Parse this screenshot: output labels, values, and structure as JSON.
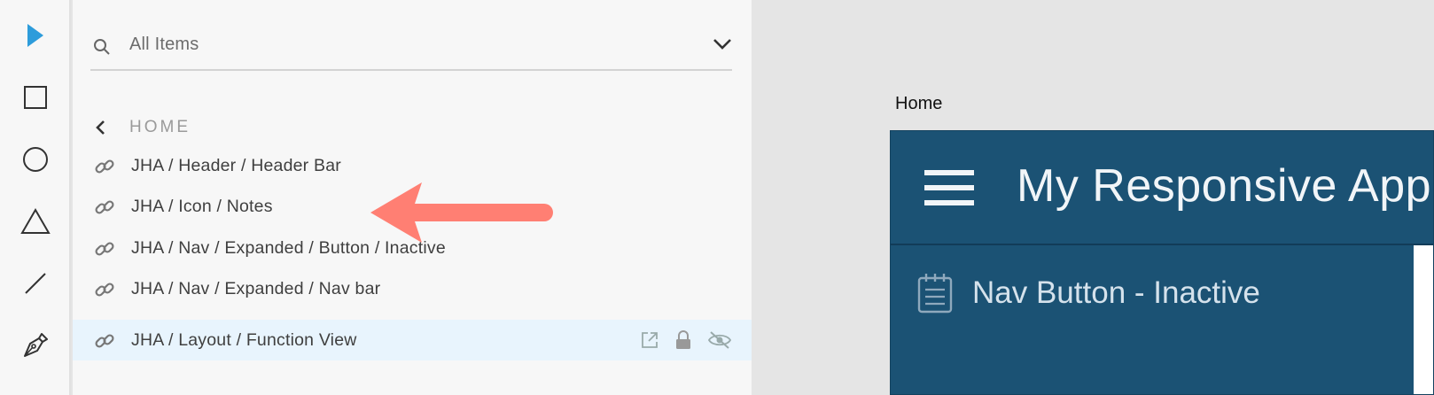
{
  "toolbar": {
    "tools": [
      {
        "icon": "select-arrow-icon"
      },
      {
        "icon": "rectangle-icon"
      },
      {
        "icon": "ellipse-icon"
      },
      {
        "icon": "triangle-icon"
      },
      {
        "icon": "line-icon"
      },
      {
        "icon": "pen-icon"
      }
    ]
  },
  "layers_panel": {
    "search": {
      "value": "All Items",
      "icon": "search-icon",
      "dropdown_icon": "chevron-down-icon"
    },
    "breadcrumb": {
      "label": "HOME",
      "back_icon": "chevron-left-icon"
    },
    "items": [
      {
        "label": "JHA / Header / Header Bar",
        "icon": "link-icon"
      },
      {
        "label": "JHA / Icon / Notes",
        "icon": "link-icon"
      },
      {
        "label": "JHA / Nav / Expanded / Button / Inactive",
        "icon": "link-icon"
      },
      {
        "label": "JHA / Nav / Expanded / Nav bar",
        "icon": "link-icon"
      },
      {
        "label": "JHA / Layout / Function View",
        "icon": "link-icon",
        "selected": true,
        "actions": [
          "external-link-icon",
          "lock-icon",
          "eye-hidden-icon"
        ]
      }
    ],
    "annotation": {
      "icon": "pointer-arrow-icon",
      "color": "#ff7f73"
    }
  },
  "canvas": {
    "artboard_label": "Home",
    "app": {
      "title": "My Responsive App",
      "menu_icon": "hamburger-menu-icon",
      "nav_button": {
        "label": "Nav Button - Inactive",
        "icon": "notes-icon"
      },
      "colors": {
        "primary": "#1b5274",
        "text": "#f1f5f8"
      }
    }
  },
  "colors": {
    "accent": "#2d9cdb",
    "panel_bg": "#f7f7f7",
    "selected_row": "#e8f4fd",
    "canvas_bg": "#e5e5e5"
  }
}
